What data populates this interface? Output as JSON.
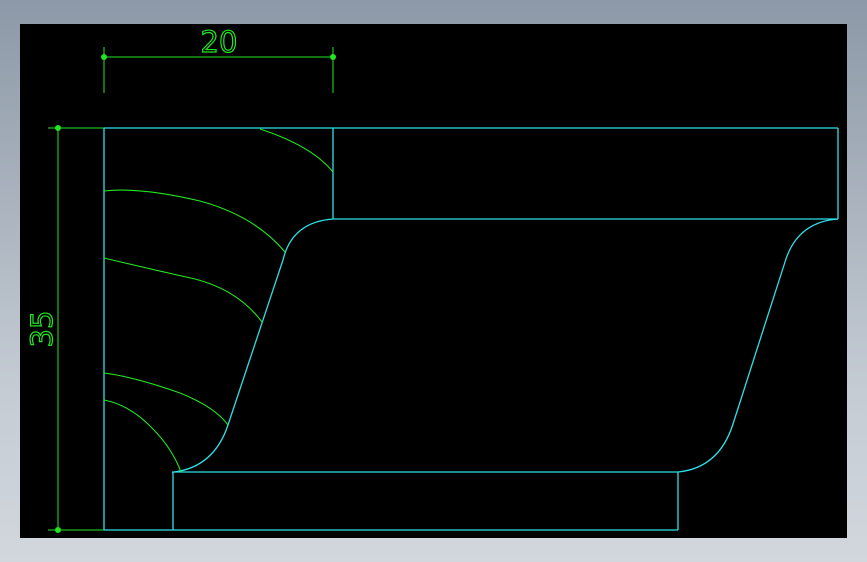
{
  "drawing": {
    "dimension_horizontal": "20",
    "dimension_vertical": "35"
  },
  "colors": {
    "profile_outline": "#2fe0e8",
    "hatch_lines": "#22e622",
    "dimension": "#22e622",
    "viewport_background": "#000000"
  }
}
